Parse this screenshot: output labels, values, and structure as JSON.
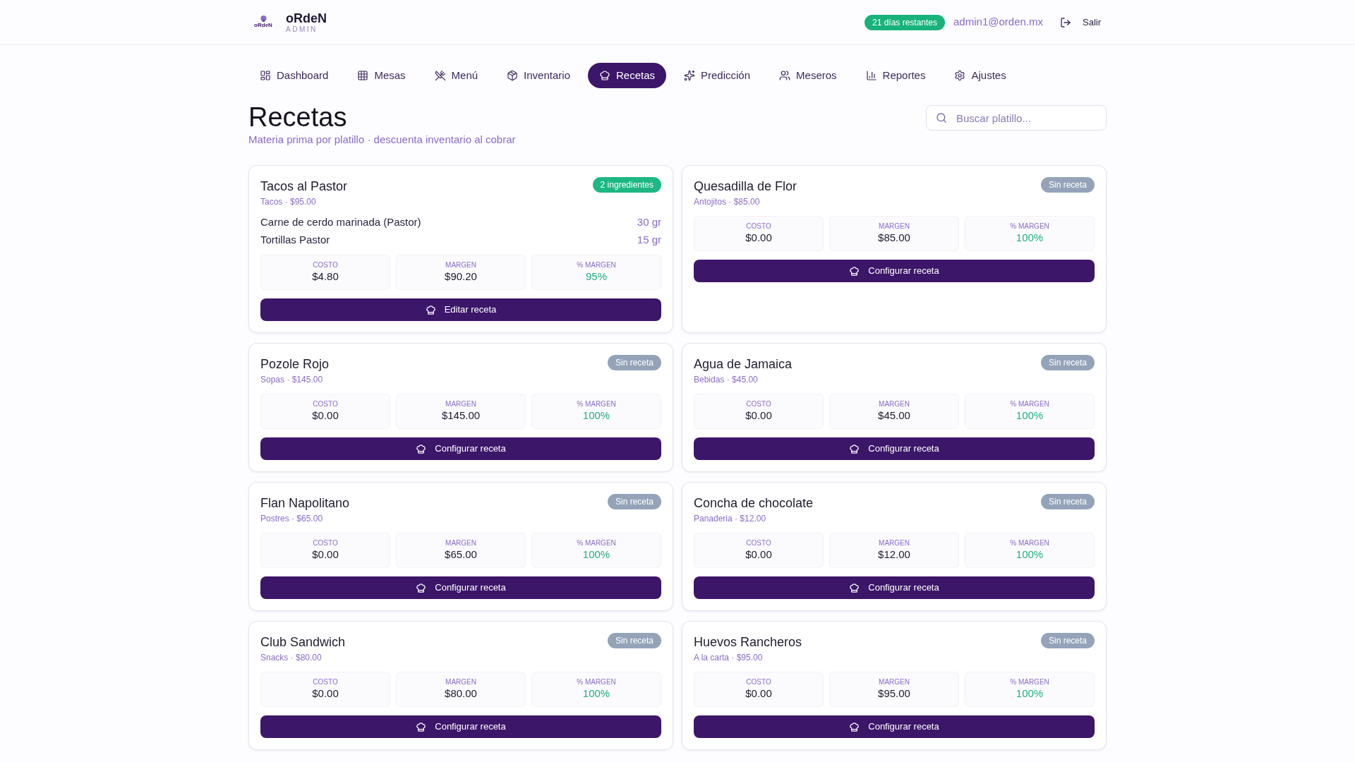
{
  "header": {
    "logo_text": "oRdeN",
    "brand": "oRdeN",
    "subtitle": "ADMIN",
    "trial_badge": "21 días restantes",
    "user_email": "admin1@orden.mx",
    "logout_label": "Salir"
  },
  "nav": [
    {
      "label": "Dashboard",
      "selected": false
    },
    {
      "label": "Mesas",
      "selected": false
    },
    {
      "label": "Menú",
      "selected": false
    },
    {
      "label": "Inventario",
      "selected": false
    },
    {
      "label": "Recetas",
      "selected": true
    },
    {
      "label": "Predicción",
      "selected": false
    },
    {
      "label": "Meseros",
      "selected": false
    },
    {
      "label": "Reportes",
      "selected": false
    },
    {
      "label": "Ajustes",
      "selected": false
    }
  ],
  "page": {
    "title": "Recetas",
    "subtitle": "Materia prima por platillo · descuenta inventario al cobrar"
  },
  "search": {
    "placeholder": "Buscar platillo..."
  },
  "recipes": [
    {
      "name": "Tacos al Pastor",
      "category_price": "Tacos · $95.00",
      "badge": {
        "kind": "ingredients",
        "label": "2 ingredientes"
      },
      "ingredients": [
        {
          "name": "Carne de cerdo marinada (Pastor)",
          "quantity": "30 gr"
        },
        {
          "name": "Tortillas Pastor",
          "quantity": "15 gr"
        }
      ],
      "stats": [
        {
          "kind": "amount",
          "label": "COSTO",
          "value": "$4.80"
        },
        {
          "kind": "amount",
          "label": "MARGEN",
          "value": "$90.20"
        },
        {
          "kind": "percent",
          "label": "% MARGEN",
          "value": "95%"
        }
      ],
      "action": "Editar receta"
    },
    {
      "name": "Quesadilla de Flor",
      "category_price": "Antojitos · $85.00",
      "badge": {
        "kind": "none",
        "label": "Sin receta"
      },
      "stats": [
        {
          "kind": "amount",
          "label": "COSTO",
          "value": "$0.00"
        },
        {
          "kind": "amount",
          "label": "MARGEN",
          "value": "$85.00"
        },
        {
          "kind": "percent",
          "label": "% MARGEN",
          "value": "100%"
        }
      ],
      "action": "Configurar receta"
    },
    {
      "name": "Pozole Rojo",
      "category_price": "Sopas · $145.00",
      "badge": {
        "kind": "none",
        "label": "Sin receta"
      },
      "stats": [
        {
          "kind": "amount",
          "label": "COSTO",
          "value": "$0.00"
        },
        {
          "kind": "amount",
          "label": "MARGEN",
          "value": "$145.00"
        },
        {
          "kind": "percent",
          "label": "% MARGEN",
          "value": "100%"
        }
      ],
      "action": "Configurar receta"
    },
    {
      "name": "Agua de Jamaica",
      "category_price": "Bebidas · $45.00",
      "badge": {
        "kind": "none",
        "label": "Sin receta"
      },
      "stats": [
        {
          "kind": "amount",
          "label": "COSTO",
          "value": "$0.00"
        },
        {
          "kind": "amount",
          "label": "MARGEN",
          "value": "$45.00"
        },
        {
          "kind": "percent",
          "label": "% MARGEN",
          "value": "100%"
        }
      ],
      "action": "Configurar receta"
    },
    {
      "name": "Flan Napolitano",
      "category_price": "Postres · $65.00",
      "badge": {
        "kind": "none",
        "label": "Sin receta"
      },
      "stats": [
        {
          "kind": "amount",
          "label": "COSTO",
          "value": "$0.00"
        },
        {
          "kind": "amount",
          "label": "MARGEN",
          "value": "$65.00"
        },
        {
          "kind": "percent",
          "label": "% MARGEN",
          "value": "100%"
        }
      ],
      "action": "Configurar receta"
    },
    {
      "name": "Concha de chocolate",
      "category_price": "Panaderia · $12.00",
      "badge": {
        "kind": "none",
        "label": "Sin receta"
      },
      "stats": [
        {
          "kind": "amount",
          "label": "COSTO",
          "value": "$0.00"
        },
        {
          "kind": "amount",
          "label": "MARGEN",
          "value": "$12.00"
        },
        {
          "kind": "percent",
          "label": "% MARGEN",
          "value": "100%"
        }
      ],
      "action": "Configurar receta"
    },
    {
      "name": "Club Sandwich",
      "category_price": "Snacks · $80.00",
      "badge": {
        "kind": "none",
        "label": "Sin receta"
      },
      "stats": [
        {
          "kind": "amount",
          "label": "COSTO",
          "value": "$0.00"
        },
        {
          "kind": "amount",
          "label": "MARGEN",
          "value": "$80.00"
        },
        {
          "kind": "percent",
          "label": "% MARGEN",
          "value": "100%"
        }
      ],
      "action": "Configurar receta"
    },
    {
      "name": "Huevos Rancheros",
      "category_price": "A la carta · $95.00",
      "badge": {
        "kind": "none",
        "label": "Sin receta"
      },
      "stats": [
        {
          "kind": "amount",
          "label": "COSTO",
          "value": "$0.00"
        },
        {
          "kind": "amount",
          "label": "MARGEN",
          "value": "$95.00"
        },
        {
          "kind": "percent",
          "label": "% MARGEN",
          "value": "100%"
        }
      ],
      "action": "Configurar receta"
    }
  ]
}
